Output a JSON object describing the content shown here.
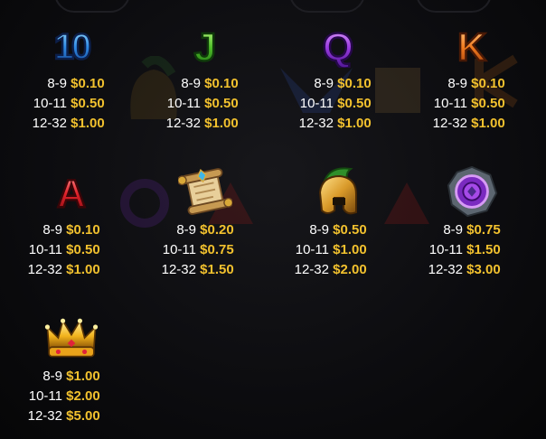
{
  "colors": {
    "background": "#0b0b0d",
    "count_text": "#ffffff",
    "payout_text": "#f2c12e"
  },
  "symbols": [
    {
      "id": "10",
      "label": "10",
      "icon": "ten-card-icon",
      "pays": [
        {
          "count": "8-9",
          "value": "$0.10"
        },
        {
          "count": "10-11",
          "value": "$0.50"
        },
        {
          "count": "12-32",
          "value": "$1.00"
        }
      ]
    },
    {
      "id": "J",
      "label": "J",
      "icon": "jack-card-icon",
      "pays": [
        {
          "count": "8-9",
          "value": "$0.10"
        },
        {
          "count": "10-11",
          "value": "$0.50"
        },
        {
          "count": "12-32",
          "value": "$1.00"
        }
      ]
    },
    {
      "id": "Q",
      "label": "Q",
      "icon": "queen-card-icon",
      "pays": [
        {
          "count": "8-9",
          "value": "$0.10"
        },
        {
          "count": "10-11",
          "value": "$0.50"
        },
        {
          "count": "12-32",
          "value": "$1.00"
        }
      ]
    },
    {
      "id": "K",
      "label": "K",
      "icon": "king-card-icon",
      "pays": [
        {
          "count": "8-9",
          "value": "$0.10"
        },
        {
          "count": "10-11",
          "value": "$0.50"
        },
        {
          "count": "12-32",
          "value": "$1.00"
        }
      ]
    },
    {
      "id": "A",
      "label": "A",
      "icon": "ace-card-icon",
      "pays": [
        {
          "count": "8-9",
          "value": "$0.10"
        },
        {
          "count": "10-11",
          "value": "$0.50"
        },
        {
          "count": "12-32",
          "value": "$1.00"
        }
      ]
    },
    {
      "id": "scroll",
      "icon": "scroll-icon",
      "pays": [
        {
          "count": "8-9",
          "value": "$0.20"
        },
        {
          "count": "10-11",
          "value": "$0.75"
        },
        {
          "count": "12-32",
          "value": "$1.50"
        }
      ]
    },
    {
      "id": "helmet",
      "icon": "spartan-helmet-icon",
      "pays": [
        {
          "count": "8-9",
          "value": "$0.50"
        },
        {
          "count": "10-11",
          "value": "$1.00"
        },
        {
          "count": "12-32",
          "value": "$2.00"
        }
      ]
    },
    {
      "id": "shield",
      "icon": "shield-gem-icon",
      "pays": [
        {
          "count": "8-9",
          "value": "$0.75"
        },
        {
          "count": "10-11",
          "value": "$1.50"
        },
        {
          "count": "12-32",
          "value": "$3.00"
        }
      ]
    },
    {
      "id": "crown",
      "icon": "crown-icon",
      "pays": [
        {
          "count": "8-9",
          "value": "$1.00"
        },
        {
          "count": "10-11",
          "value": "$2.00"
        },
        {
          "count": "12-32",
          "value": "$5.00"
        }
      ]
    }
  ]
}
